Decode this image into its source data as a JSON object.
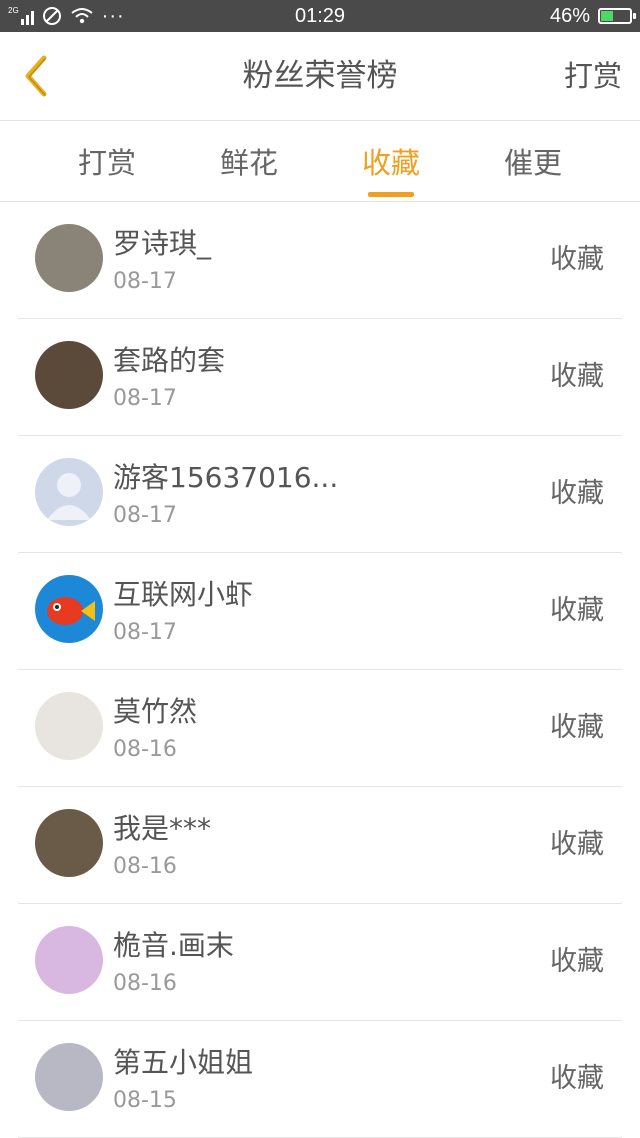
{
  "status_bar": {
    "signal_label": "2G",
    "time": "01:29",
    "battery_percent": "46%",
    "battery_level": 0.46,
    "dots": "···"
  },
  "header": {
    "title": "粉丝荣誉榜",
    "right_link": "打赏",
    "accent_color": "#f0a020"
  },
  "tabs": [
    {
      "label": "打赏",
      "active": false
    },
    {
      "label": "鲜花",
      "active": false
    },
    {
      "label": "收藏",
      "active": true
    },
    {
      "label": "催更",
      "active": false
    }
  ],
  "fans": [
    {
      "name": "罗诗琪_",
      "date": "08-17",
      "action": "收藏",
      "avatar_color": "#8a8478"
    },
    {
      "name": "套路的套",
      "date": "08-17",
      "action": "收藏",
      "avatar_color": "#5b4a3a"
    },
    {
      "name": "游客15637016...",
      "date": "08-17",
      "action": "收藏",
      "avatar_color": "#cfd8e8"
    },
    {
      "name": "互联网小虾",
      "date": "08-17",
      "action": "收藏",
      "avatar_color": "#1e88d8"
    },
    {
      "name": "莫竹然",
      "date": "08-16",
      "action": "收藏",
      "avatar_color": "#e8e4e0"
    },
    {
      "name": "我是***",
      "date": "08-16",
      "action": "收藏",
      "avatar_color": "#6a5a48"
    },
    {
      "name": "桅音.画末",
      "date": "08-16",
      "action": "收藏",
      "avatar_color": "#d8b8e0"
    },
    {
      "name": "第五小姐姐",
      "date": "08-15",
      "action": "收藏",
      "avatar_color": "#b8b8c4"
    }
  ]
}
